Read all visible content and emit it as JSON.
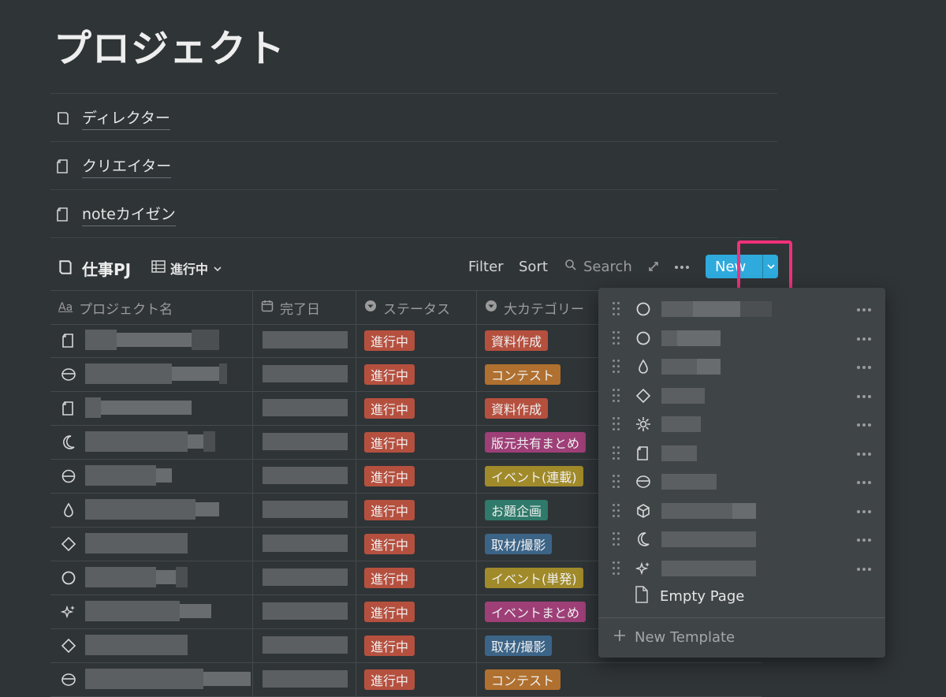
{
  "page": {
    "title": "プロジェクト",
    "links": [
      {
        "label": "ディレクター",
        "icon": "book-icon"
      },
      {
        "label": "クリエイター",
        "icon": "page-icon"
      },
      {
        "label": "noteカイゼン",
        "icon": "page-icon"
      }
    ]
  },
  "database": {
    "title": "仕事PJ",
    "view_label": "進行中",
    "toolbar": {
      "filter": "Filter",
      "sort": "Sort",
      "search": "Search",
      "new": "New"
    },
    "columns": [
      {
        "label": "プロジェクト名",
        "icon": "Aa"
      },
      {
        "label": "完了日",
        "icon": "calendar-icon"
      },
      {
        "label": "ステータス",
        "icon": "select-icon"
      },
      {
        "label": "大カテゴリー",
        "icon": "select-icon"
      }
    ],
    "rows": [
      {
        "icon": "page-icon",
        "status": "進行中",
        "category": "資料作成",
        "category_color": "#b5503f"
      },
      {
        "icon": "disc-icon",
        "status": "進行中",
        "category": "コンテスト",
        "category_color": "#b0702f"
      },
      {
        "icon": "page-icon",
        "status": "進行中",
        "category": "資料作成",
        "category_color": "#b5503f"
      },
      {
        "icon": "moon-icon",
        "status": "進行中",
        "category": "版元共有まとめ",
        "category_color": "#9e3f78"
      },
      {
        "icon": "minus-circle-icon",
        "status": "進行中",
        "category": "イベント(連載)",
        "category_color": "#a08a2a"
      },
      {
        "icon": "drop-icon",
        "status": "進行中",
        "category": "お題企画",
        "category_color": "#2f7a6a"
      },
      {
        "icon": "diamond-icon",
        "status": "進行中",
        "category": "取材/撮影",
        "category_color": "#3c6487"
      },
      {
        "icon": "circle-icon",
        "status": "進行中",
        "category": "イベント(単発)",
        "category_color": "#a08a2a"
      },
      {
        "icon": "sparkle-icon",
        "status": "進行中",
        "category": "イベントまとめ",
        "category_color": "#9e3f78"
      },
      {
        "icon": "diamond-icon",
        "status": "進行中",
        "category": "取材/撮影",
        "category_color": "#3c6487"
      },
      {
        "icon": "disc-icon",
        "status": "進行中",
        "category": "コンテスト",
        "category_color": "#b0702f"
      }
    ],
    "status_color": "#b5503f"
  },
  "template_menu": {
    "items": [
      {
        "icon": "circle-icon"
      },
      {
        "icon": "circle-icon"
      },
      {
        "icon": "drop-icon"
      },
      {
        "icon": "diamond-icon"
      },
      {
        "icon": "sun-icon"
      },
      {
        "icon": "page-icon"
      },
      {
        "icon": "disc-icon"
      },
      {
        "icon": "cube-icon"
      },
      {
        "icon": "moon-icon"
      },
      {
        "icon": "sparkle-icon"
      }
    ],
    "empty_page": "Empty Page",
    "new_template": "New Template"
  },
  "colors": {
    "background": "#2f3437",
    "accent": "#2eaadc",
    "highlight": "#f0307a"
  }
}
